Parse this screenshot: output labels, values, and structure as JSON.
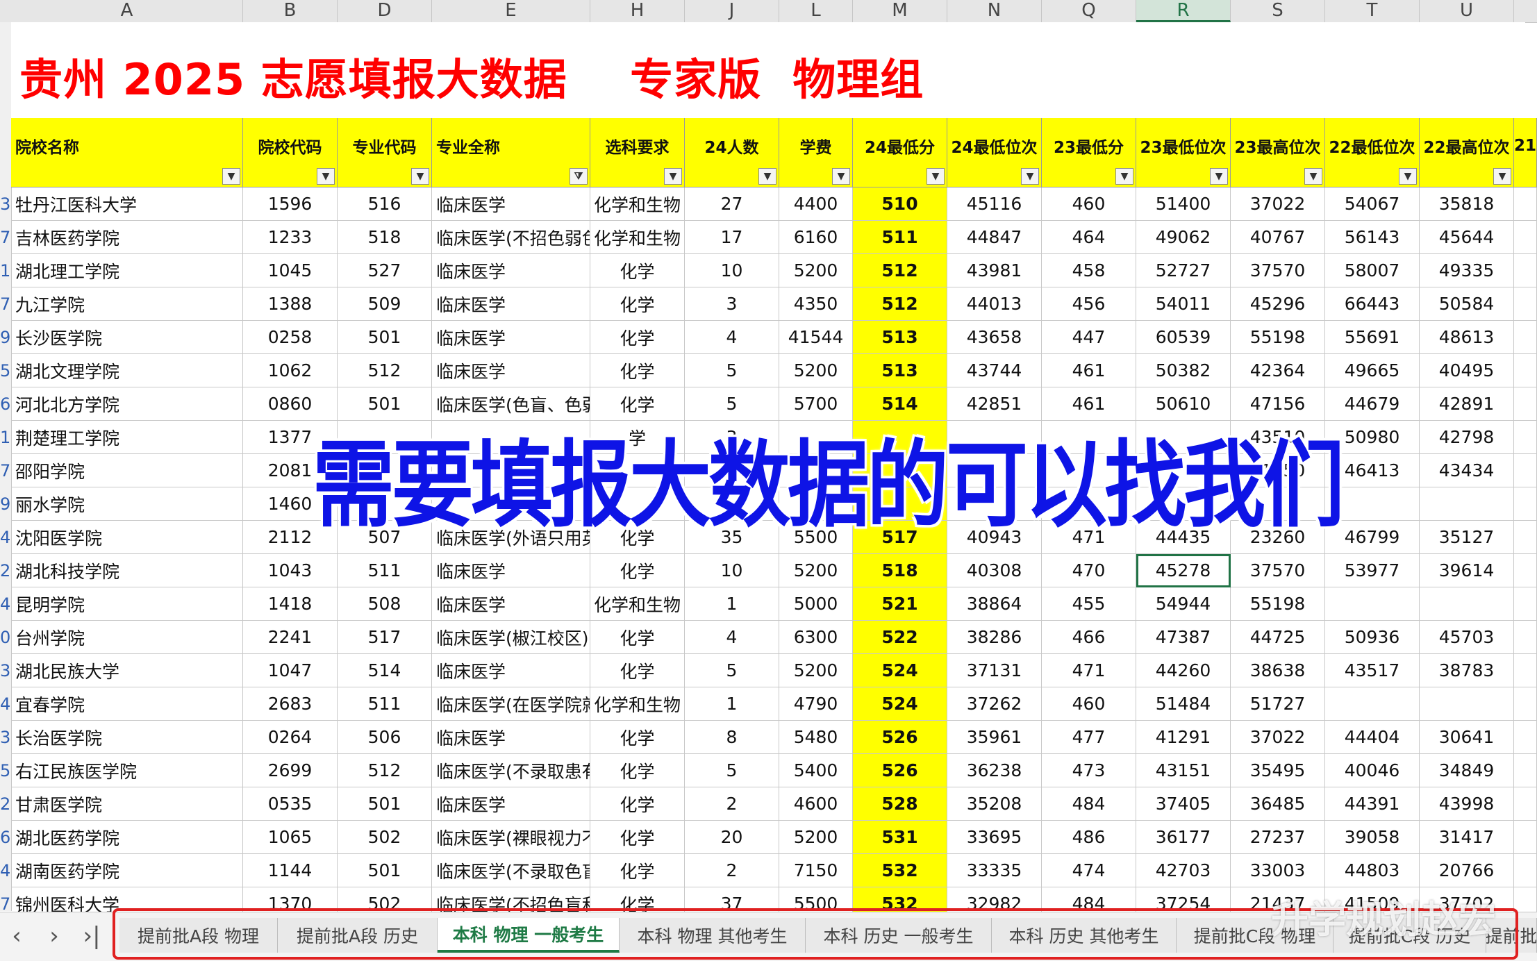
{
  "column_letters": [
    "A",
    "B",
    "D",
    "E",
    "H",
    "J",
    "L",
    "M",
    "N",
    "Q",
    "R",
    "S",
    "T",
    "U"
  ],
  "active_column": "R",
  "title": "贵州 2025 志愿填报大数据    专家版  物理组",
  "headers": [
    "院校名称",
    "院校代码",
    "专业代码",
    "专业全称",
    "选科要求",
    "24人数",
    "学费",
    "24最低分",
    "24最低位次",
    "23最低分",
    "23最低位次",
    "23最高位次",
    "22最低位次",
    "22最高位次",
    "21"
  ],
  "row_numbers": [
    "3",
    "7",
    "1",
    "7",
    "9",
    "5",
    "6",
    "1",
    "7",
    "9",
    "4",
    "2",
    "4",
    "0",
    "3",
    "4",
    "3",
    "5",
    "2",
    "6",
    "4",
    "7"
  ],
  "rows": [
    [
      "牡丹江医科大学",
      "1596",
      "516",
      "临床医学",
      "化学和生物",
      "27",
      "4400",
      "510",
      "45116",
      "460",
      "51400",
      "37022",
      "54067",
      "35818"
    ],
    [
      "吉林医药学院",
      "1233",
      "518",
      "临床医学(不招色弱色",
      "化学和生物",
      "17",
      "6160",
      "511",
      "44847",
      "464",
      "49062",
      "40767",
      "56143",
      "45644"
    ],
    [
      "湖北理工学院",
      "1045",
      "527",
      "临床医学",
      "化学",
      "10",
      "5200",
      "512",
      "43981",
      "458",
      "52727",
      "37570",
      "58007",
      "49335"
    ],
    [
      "九江学院",
      "1388",
      "509",
      "临床医学",
      "化学",
      "3",
      "4350",
      "512",
      "44013",
      "456",
      "54011",
      "45296",
      "66443",
      "50584"
    ],
    [
      "长沙医学院",
      "0258",
      "501",
      "临床医学",
      "化学",
      "4",
      "41544",
      "513",
      "43658",
      "447",
      "60539",
      "55198",
      "55691",
      "48613"
    ],
    [
      "湖北文理学院",
      "1062",
      "512",
      "临床医学",
      "化学",
      "5",
      "5200",
      "513",
      "43744",
      "461",
      "50382",
      "42364",
      "49665",
      "40495"
    ],
    [
      "河北北方学院",
      "0860",
      "501",
      "临床医学(色盲、色弱",
      "化学",
      "5",
      "5700",
      "514",
      "42851",
      "461",
      "50610",
      "47156",
      "44679",
      "42891"
    ],
    [
      "荆楚理工学院",
      "1377",
      "",
      "",
      "学",
      "3",
      "",
      "",
      "",
      "",
      "",
      "43510",
      "50980",
      "42798"
    ],
    [
      "邵阳学院",
      "2081",
      "",
      "",
      "",
      "",
      "",
      "",
      "",
      "",
      "",
      "51050",
      "46413",
      "43434"
    ],
    [
      "丽水学院",
      "1460",
      "",
      "",
      "",
      "",
      "",
      "",
      "",
      "",
      "",
      "",
      "",
      ""
    ],
    [
      "沈阳医学院",
      "2112",
      "507",
      "临床医学(外语只用英",
      "化学",
      "35",
      "5500",
      "517",
      "40943",
      "471",
      "44435",
      "23260",
      "46799",
      "35127"
    ],
    [
      "湖北科技学院",
      "1043",
      "511",
      "临床医学",
      "化学",
      "10",
      "5200",
      "518",
      "40308",
      "470",
      "45278",
      "37570",
      "53977",
      "39614"
    ],
    [
      "昆明学院",
      "1418",
      "508",
      "临床医学",
      "化学和生物",
      "1",
      "5000",
      "521",
      "38864",
      "455",
      "54944",
      "55198",
      "",
      ""
    ],
    [
      "台州学院",
      "2241",
      "517",
      "临床医学(椒江校区)",
      "化学",
      "4",
      "6300",
      "522",
      "38286",
      "466",
      "47387",
      "44725",
      "50936",
      "45703"
    ],
    [
      "湖北民族大学",
      "1047",
      "514",
      "临床医学",
      "化学",
      "5",
      "5200",
      "524",
      "37131",
      "471",
      "44260",
      "38638",
      "43517",
      "38783"
    ],
    [
      "宜春学院",
      "2683",
      "511",
      "临床医学(在医学院就",
      "化学和生物",
      "1",
      "4790",
      "524",
      "37262",
      "460",
      "51484",
      "51727",
      "",
      ""
    ],
    [
      "长治医学院",
      "0264",
      "506",
      "临床医学",
      "化学",
      "8",
      "5480",
      "526",
      "35961",
      "477",
      "41291",
      "37022",
      "44404",
      "30641"
    ],
    [
      "右江民族医学院",
      "2699",
      "512",
      "临床医学(不录取患有",
      "化学",
      "5",
      "5400",
      "526",
      "36238",
      "473",
      "43151",
      "35495",
      "40046",
      "34849"
    ],
    [
      "甘肃医学院",
      "0535",
      "501",
      "临床医学",
      "化学",
      "2",
      "4600",
      "528",
      "35208",
      "484",
      "37405",
      "36485",
      "44391",
      "43998"
    ],
    [
      "湖北医药学院",
      "1065",
      "502",
      "临床医学(裸眼视力不",
      "化学",
      "20",
      "5200",
      "531",
      "33695",
      "486",
      "36177",
      "27237",
      "39058",
      "31417"
    ],
    [
      "湖南医药学院",
      "1144",
      "501",
      "临床医学(不录取色盲",
      "化学",
      "2",
      "7150",
      "532",
      "33335",
      "474",
      "42703",
      "33003",
      "44803",
      "20766"
    ],
    [
      "锦州医科大学",
      "1370",
      "502",
      "临床医学(不招色盲和",
      "化学",
      "37",
      "5500",
      "532",
      "32982",
      "484",
      "37254",
      "21437",
      "41509",
      "37702"
    ]
  ],
  "overlay": "需要填报大数据的可以找我们",
  "tabs": [
    "提前批A段 物理",
    "提前批A段 历史",
    "本科 物理 一般考生",
    "本科 物理 其他考生",
    "本科 历史 一般考生",
    "本科 历史 其他考生",
    "提前批C段 物理",
    "提前批C段 历史",
    "提前批"
  ],
  "active_tab": 2,
  "watermark": "升学规划赵宏",
  "icons": {
    "filter": "filter-dropdown-icon",
    "nav_prev": "chevron-left-icon",
    "nav_next": "chevron-right-icon",
    "nav_last": "chevron-last-icon"
  }
}
